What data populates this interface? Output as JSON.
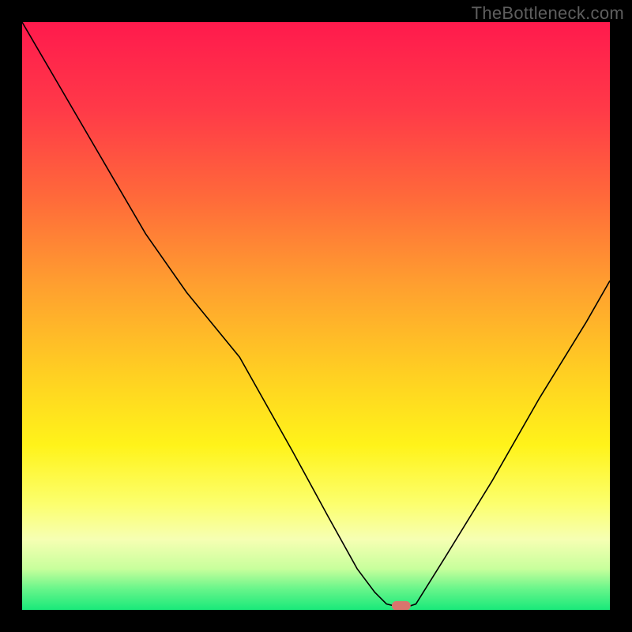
{
  "watermark": "TheBottleneck.com",
  "chart_data": {
    "type": "line",
    "title": "",
    "xlabel": "",
    "ylabel": "",
    "xlim": [
      0,
      100
    ],
    "ylim": [
      0,
      100
    ],
    "background_gradient_stops": [
      {
        "offset": 0.0,
        "color": "#ff1a4d"
      },
      {
        "offset": 0.15,
        "color": "#ff3a48"
      },
      {
        "offset": 0.3,
        "color": "#ff6a3a"
      },
      {
        "offset": 0.45,
        "color": "#ffa02f"
      },
      {
        "offset": 0.6,
        "color": "#ffd022"
      },
      {
        "offset": 0.72,
        "color": "#fff31a"
      },
      {
        "offset": 0.82,
        "color": "#fcff6e"
      },
      {
        "offset": 0.88,
        "color": "#f6ffb3"
      },
      {
        "offset": 0.93,
        "color": "#c8ff9c"
      },
      {
        "offset": 0.965,
        "color": "#66f58a"
      },
      {
        "offset": 1.0,
        "color": "#19e97a"
      }
    ],
    "series": [
      {
        "name": "bottleneck-curve",
        "x": [
          0,
          7,
          14,
          21,
          28,
          37,
          46,
          52,
          57,
          60,
          62,
          64,
          65.5,
          67,
          72,
          80,
          88,
          96,
          100
        ],
        "y": [
          100,
          88,
          76,
          64,
          54,
          43,
          27,
          16,
          7,
          3,
          1,
          0.5,
          0.5,
          1,
          9,
          22,
          36,
          49,
          56
        ]
      }
    ],
    "marker": {
      "name": "optimal-point",
      "x": 64.5,
      "y": 0.7,
      "width": 3.2,
      "height": 1.6,
      "color": "#d9756d"
    }
  }
}
